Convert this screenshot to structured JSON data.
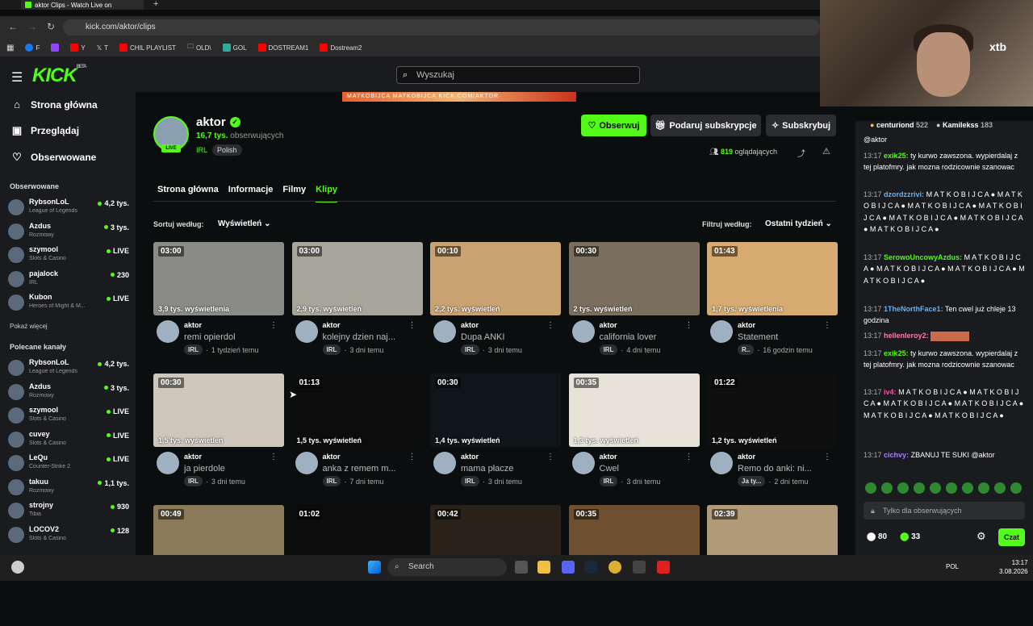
{
  "browser": {
    "tab_title": "aktor Clips - Watch Live on",
    "url": "kick.com/aktor/clips",
    "bookmarks": [
      "F",
      "",
      "Y",
      "T",
      "CHIL PLAYLIST",
      "OLD\\",
      "GOL",
      "DOSTREAM1",
      "Dostream2"
    ]
  },
  "header": {
    "logo": "KICK",
    "logo_beta": "BETA",
    "search_placeholder": "Wyszukaj"
  },
  "sidebar": {
    "nav": [
      {
        "label": "Strona główna",
        "icon": "home-icon"
      },
      {
        "label": "Przeglądaj",
        "icon": "browse-icon"
      },
      {
        "label": "Obserwowane",
        "icon": "heart-icon"
      }
    ],
    "followed_heading": "Obserwowane",
    "followed": [
      {
        "name": "RybsonLoL",
        "game": "League of Legends",
        "viewers": "4,2 tys."
      },
      {
        "name": "Azdus",
        "game": "Rozmowy",
        "viewers": "3 tys."
      },
      {
        "name": "szymool",
        "game": "Slots & Casino",
        "viewers": "LIVE"
      },
      {
        "name": "pajalock",
        "game": "IRL",
        "viewers": "230"
      },
      {
        "name": "Kubon",
        "game": "Heroes of Might & M...",
        "viewers": "LIVE"
      }
    ],
    "show_more": "Pokaż więcej",
    "recommended_heading": "Polecane kanały",
    "recommended": [
      {
        "name": "RybsonLoL",
        "game": "League of Legends",
        "viewers": "4,2 tys."
      },
      {
        "name": "Azdus",
        "game": "Rozmowy",
        "viewers": "3 tys."
      },
      {
        "name": "szymool",
        "game": "Slots & Casino",
        "viewers": "LIVE"
      },
      {
        "name": "cuvey",
        "game": "Slots & Casino",
        "viewers": "LIVE"
      },
      {
        "name": "LeQu",
        "game": "Counter-Strike 2",
        "viewers": "LIVE"
      },
      {
        "name": "takuu",
        "game": "Rozmowy",
        "viewers": "1,1 tys."
      },
      {
        "name": "strojny",
        "game": "Tibia",
        "viewers": "930"
      },
      {
        "name": "LOCOV2",
        "game": "Slots & Casino",
        "viewers": "128"
      }
    ]
  },
  "channel": {
    "name": "aktor",
    "live": "LIVE",
    "followers_count": "16,7 tys.",
    "followers_label": "obserwujących",
    "category": "IRL",
    "language": "Polish",
    "follow": "Obserwuj",
    "gift": "Podaruj subskrypcje",
    "subscribe": "Subskrybuj",
    "viewers_count": "819",
    "viewers_label": "oglądających",
    "banner_text": "MATKOBIJCA MATKOBIJCA KICK.COM/AKTOR"
  },
  "tabs": [
    "Strona główna",
    "Informacje",
    "Filmy",
    "Klipy"
  ],
  "controls": {
    "sort_label": "Sortuj według:",
    "sort_value": "Wyświetleń",
    "filter_label": "Filtruj według:",
    "filter_value": "Ostatni tydzień"
  },
  "clips": [
    {
      "dur": "03:00",
      "views": "3,9 tys. wyświetlenia",
      "owner": "aktor",
      "title": "remi opierdol",
      "tag": "IRL",
      "ago": "1 tydzień temu",
      "bg": "#8a8a86"
    },
    {
      "dur": "03:00",
      "views": "2,9 tys. wyświetleń",
      "owner": "aktor",
      "title": "kolejny dzien naj...",
      "tag": "IRL",
      "ago": "3 dni temu",
      "bg": "#a8a59a"
    },
    {
      "dur": "00:10",
      "views": "2,2 tys. wyświetleń",
      "owner": "aktor",
      "title": "Dupa ANKI",
      "tag": "IRL",
      "ago": "3 dni temu",
      "bg": "#c9a272"
    },
    {
      "dur": "00:30",
      "views": "2 tys. wyświetleń",
      "owner": "aktor",
      "title": "california lover",
      "tag": "IRL",
      "ago": "4 dni temu",
      "bg": "#7a6e5e"
    },
    {
      "dur": "01:43",
      "views": "1,7 tys. wyświetlenia",
      "owner": "aktor",
      "title": "Statement",
      "tag": "R..",
      "ago": "16 godzin temu",
      "bg": "#d6aa70"
    },
    {
      "dur": "00:30",
      "views": "1,5 tys. wyświetleń",
      "owner": "aktor",
      "title": "ja pierdole",
      "tag": "IRL",
      "ago": "3 dni temu",
      "bg": "#cfc6bb"
    },
    {
      "dur": "01:13",
      "views": "1,5 tys. wyświetleń",
      "owner": "aktor",
      "title": "anka z remem m...",
      "tag": "IRL",
      "ago": "7 dni temu",
      "bg": "#0c0c0c"
    },
    {
      "dur": "00:30",
      "views": "1,4 tys. wyświetleń",
      "owner": "aktor",
      "title": "mama płacze",
      "tag": "IRL",
      "ago": "3 dni temu",
      "bg": "#10151a"
    },
    {
      "dur": "00:35",
      "views": "1,3 tys. wyświetleń",
      "owner": "aktor",
      "title": "Cwel",
      "tag": "IRL",
      "ago": "3 dni temu",
      "bg": "#e8e3d8"
    },
    {
      "dur": "01:22",
      "views": "1,2 tys. wyświetleń",
      "owner": "aktor",
      "title": "Remo do anki: ni...",
      "tag": "Ja ty...",
      "ago": "2 dni temu",
      "bg": "#0e0f0e"
    },
    {
      "dur": "00:49",
      "views": "",
      "owner": "",
      "title": "",
      "tag": "",
      "ago": "",
      "bg": "#8a7a5a"
    },
    {
      "dur": "01:02",
      "views": "",
      "owner": "",
      "title": "",
      "tag": "",
      "ago": "",
      "bg": "#0c0c0c"
    },
    {
      "dur": "00:42",
      "views": "",
      "owner": "",
      "title": "",
      "tag": "",
      "ago": "",
      "bg": "#2a2218"
    },
    {
      "dur": "00:35",
      "views": "",
      "owner": "",
      "title": "",
      "tag": "",
      "ago": "",
      "bg": "#6e5030"
    },
    {
      "dur": "02:39",
      "views": "",
      "owner": "",
      "title": "",
      "tag": "",
      "ago": "",
      "bg": "#b09a78"
    }
  ],
  "chat": {
    "top_gifters": [
      {
        "name": "centuriond",
        "count": "522"
      },
      {
        "name": "Kamilekss",
        "count": "183"
      }
    ],
    "messages": [
      {
        "time": "",
        "user": "",
        "color": "#fff",
        "text": "@aktor"
      },
      {
        "time": "13:17",
        "user": "exik25:",
        "color": "#53fc18",
        "text": "ty kurwo zawszona. wypierdalaj z tej platofmry. jak mozna rodzicownie szanowac"
      },
      {
        "time": "13:17",
        "user": "dzordzzrivi:",
        "color": "#5ab4ff",
        "text": "M A T K O B I J C A ● M A T K O B I J C A ● M A T K O B I J C A ● M A T K O B I J C A ● M A T K O B I J C A ● M A T K O B I J C A ● M A T K O B I J C A ●"
      },
      {
        "time": "13:17",
        "user": "SerowoUncowyAzdus:",
        "color": "#53fc18",
        "text": "M A T K O B I J C A ● M A T K O B I J C A ● M A T K O B I J C A ● M A T K O B I J C A ●"
      },
      {
        "time": "13:17",
        "user": "1TheNorthFace1:",
        "color": "#5ab4ff",
        "text": "Ten cwel już chleje 13 godzina"
      },
      {
        "time": "13:17",
        "user": "hellenleroy2:",
        "color": "#ff7ab0",
        "text": ""
      },
      {
        "time": "13:17",
        "user": "exik25:",
        "color": "#53fc18",
        "text": "ty kurwo zawszona. wypierdalaj z tej platofmry. jak mozna rodzicownie szanowac"
      },
      {
        "time": "13:17",
        "user": "iv4:",
        "color": "#ff4fa8",
        "text": "M A T K O B I J C A ● M A T K O B I J C A ● M A T K O B I J C A ● M A T K O B I J C A ● M A T K O B I J C A ● M A T K O B I J C A ●"
      },
      {
        "time": "13:17",
        "user": "cichvy:",
        "color": "#b07aff",
        "text": "ZBANUJ TE SUKI @aktor"
      }
    ],
    "input_placeholder": "Tylko dla obserwujących",
    "stat1": "80",
    "stat2": "33",
    "send": "Czat"
  },
  "webcam": {
    "brand": "xtb"
  },
  "taskbar": {
    "search": "Search",
    "lang": "POL",
    "time": "13:17",
    "date": "3.08.2026"
  },
  "colors": {
    "kick_green": "#53fc18",
    "bg": "#0b0e0f",
    "panel": "#191b1f"
  }
}
